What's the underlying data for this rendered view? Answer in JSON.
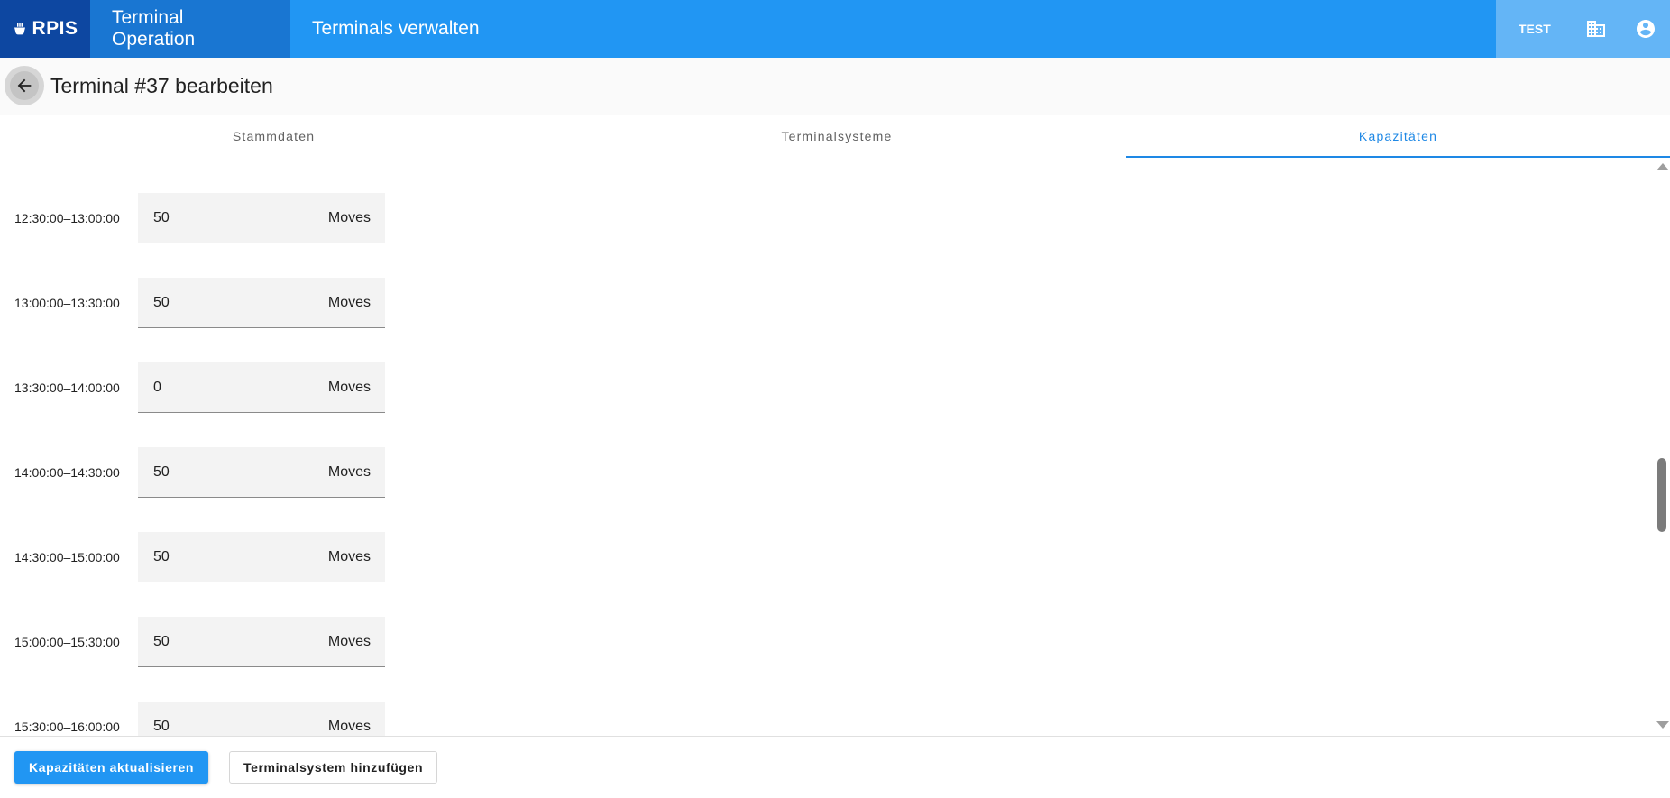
{
  "appbar": {
    "logo_text": "RPIS",
    "nav": [
      {
        "label": "Terminal Operation",
        "active": true
      },
      {
        "label": "Terminals verwalten",
        "active": false
      }
    ],
    "env_label": "TEST",
    "icons": [
      "building-icon",
      "account-circle-icon"
    ]
  },
  "page": {
    "title": "Terminal #37 bearbeiten"
  },
  "tabs": [
    {
      "label": "Stammdaten",
      "active": false
    },
    {
      "label": "Terminalsysteme",
      "active": false
    },
    {
      "label": "Kapazitäten",
      "active": true
    }
  ],
  "capacities": [
    {
      "range": "12:30:00–13:00:00",
      "value": "50",
      "unit": "Moves"
    },
    {
      "range": "13:00:00–13:30:00",
      "value": "50",
      "unit": "Moves"
    },
    {
      "range": "13:30:00–14:00:00",
      "value": "0",
      "unit": "Moves"
    },
    {
      "range": "14:00:00–14:30:00",
      "value": "50",
      "unit": "Moves"
    },
    {
      "range": "14:30:00–15:00:00",
      "value": "50",
      "unit": "Moves"
    },
    {
      "range": "15:00:00–15:30:00",
      "value": "50",
      "unit": "Moves"
    },
    {
      "range": "15:30:00–16:00:00",
      "value": "50",
      "unit": "Moves"
    }
  ],
  "footer": {
    "update_label": "Kapazitäten aktualisieren",
    "add_system_label": "Terminalsystem hinzufügen"
  },
  "colors": {
    "primary": "#2196f3",
    "primary_dark": "#0d47a1",
    "active_nav": "#1976d2",
    "accent_light": "#64b5f6",
    "tab_active": "#1e88e5"
  }
}
